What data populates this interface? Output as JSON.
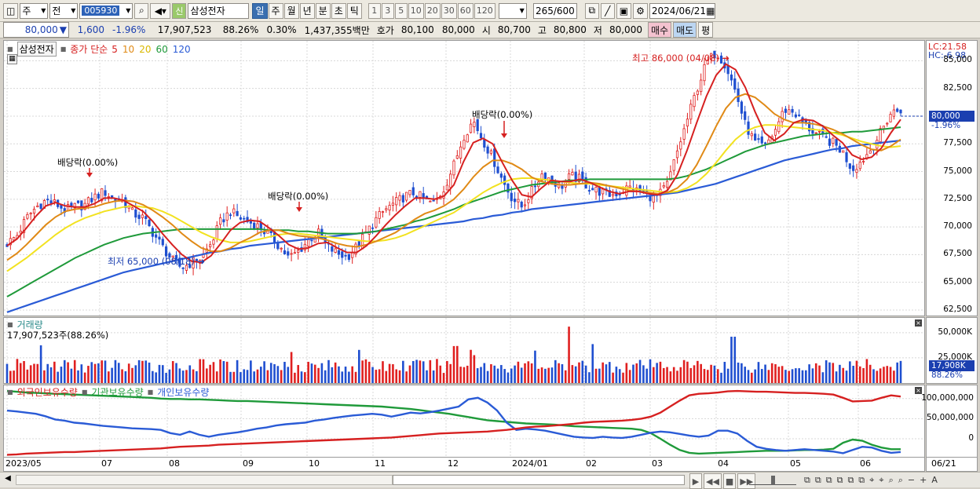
{
  "toolbar": {
    "period": "주",
    "market": "전",
    "code": "005930",
    "new_badge": "신",
    "name": "삼성전자",
    "intervals": [
      "일",
      "주",
      "월",
      "년",
      "분",
      "초",
      "틱"
    ],
    "active_interval": "일",
    "minutes": [
      "1",
      "3",
      "5",
      "10",
      "20",
      "30",
      "60",
      "120"
    ],
    "count": "265",
    "count_total": "/600",
    "date": "2024/06/21"
  },
  "quote": {
    "price": "80,000",
    "arrow": "▼",
    "change": "1,600",
    "change_pct": "-1.96%",
    "volume": "17,907,523",
    "vol_ratio": "88.26%",
    "turnover": "0.30%",
    "amount": "1,437,355백만",
    "hoga_label": "호가",
    "bid": "80,100",
    "ask": "80,000",
    "open_label": "시",
    "open": "80,700",
    "high_label": "고",
    "high": "80,800",
    "low_label": "저",
    "low": "80,000",
    "buy": "매수",
    "sell": "매도",
    "eval": "평"
  },
  "price_panel": {
    "stock_name": "삼성전자",
    "ma_label": "종가 단순",
    "ma_periods": [
      "5",
      "10",
      "20",
      "60",
      "120"
    ],
    "ma_colors": [
      "#d62020",
      "#e08a16",
      "#f2e220",
      "#1f9a3a",
      "#2a5bd6"
    ],
    "lc": "LC:21.58",
    "hc": "HC:-6.98",
    "ticks": [
      "85,000",
      "82,500",
      "80,000",
      "77,500",
      "75,000",
      "72,500",
      "70,000",
      "67,500",
      "65,000",
      "62,500"
    ],
    "current_price": "80,000",
    "current_change": "-1.96%",
    "annotations": {
      "high": "최고 86,000 (04/08)",
      "low": "최저 65,000 (08/18)",
      "div1": "배당락(0.00%)",
      "div2": "배당락(0.00%)",
      "div3": "배당락(0.00%)"
    }
  },
  "volume_panel": {
    "title": "거래량",
    "value": "17,907,523주(88.26%)",
    "ticks": [
      "50,000K",
      "25,000K"
    ],
    "current": "17,908K",
    "current_pct": "88.26%"
  },
  "holding_panel": {
    "series": [
      "외국인보유수량",
      "기관보유수량",
      "개인보유수량"
    ],
    "colors": [
      "#d62020",
      "#1f9a3a",
      "#2a5bd6"
    ],
    "ticks": [
      "100,000,000",
      "50,000,000",
      "0"
    ]
  },
  "x_axis": {
    "labels": [
      "2023/05",
      "07",
      "08",
      "09",
      "10",
      "11",
      "12",
      "2024/01",
      "02",
      "03",
      "04",
      "05",
      "06"
    ],
    "end_label": "06/21"
  },
  "chart_data": {
    "type": "line",
    "price_ylim": [
      62000,
      86800
    ],
    "price_path": [
      68500,
      69200,
      70800,
      71800,
      72400,
      72100,
      71500,
      71800,
      72000,
      72700,
      73200,
      72500,
      72300,
      71200,
      70800,
      69500,
      68200,
      67000,
      66300,
      66800,
      67200,
      68500,
      70500,
      71400,
      70800,
      70400,
      70000,
      69200,
      68300,
      67200,
      67800,
      68800,
      69500,
      68200,
      67600,
      67300,
      68200,
      69500,
      70700,
      71600,
      72200,
      72800,
      73100,
      72400,
      72100,
      73500,
      75600,
      78200,
      79600,
      77800,
      76200,
      74200,
      72600,
      71800,
      73200,
      74800,
      74300,
      73600,
      74600,
      74300,
      73500,
      73200,
      72900,
      73100,
      73600,
      73200,
      72800,
      72700,
      73900,
      76800,
      79600,
      82400,
      84800,
      85800,
      84600,
      82200,
      79200,
      77600,
      77200,
      78600,
      80600,
      80400,
      79300,
      78600,
      78000,
      77600,
      76800,
      75200,
      76000,
      77100,
      78600,
      80300,
      80600
    ],
    "ma_daily": [
      {
        "period": "5",
        "values": [
          68300,
          68900,
          69900,
          71000,
          71900,
          72200,
          71900,
          71800,
          71800,
          72100,
          72600,
          72600,
          72400,
          71900,
          71400,
          70500,
          69400,
          68400,
          67500,
          66900,
          66800,
          67400,
          68500,
          69700,
          70400,
          70600,
          70500,
          69900,
          69200,
          68400,
          68000,
          68100,
          68500,
          68600,
          68100,
          67700,
          67700,
          68300,
          69200,
          70200,
          71100,
          71900,
          72600,
          72600,
          72500,
          72800,
          73800,
          75900,
          77600,
          78000,
          77500,
          75800,
          74200,
          72900,
          72700,
          73500,
          74200,
          74100,
          74100,
          74300,
          74000,
          73600,
          73200,
          73000,
          73200,
          73200,
          73000,
          72900,
          73300,
          74700,
          76900,
          79400,
          81800,
          83700,
          84700,
          84200,
          82600,
          80400,
          78500,
          77800,
          78400,
          79400,
          79700,
          79600,
          79100,
          78300,
          77600,
          76500,
          76100,
          76300,
          77100,
          78500,
          79700
        ]
      },
      {
        "period": "10",
        "values": [
          67000,
          67600,
          68400,
          69300,
          70200,
          70900,
          71400,
          71600,
          71700,
          71800,
          72100,
          72300,
          72400,
          72300,
          72000,
          71500,
          70900,
          70200,
          69400,
          68700,
          68100,
          67800,
          67800,
          68100,
          68600,
          69000,
          69500,
          69700,
          69700,
          69400,
          69200,
          69100,
          69000,
          68800,
          68500,
          68300,
          68200,
          68400,
          68700,
          69100,
          69500,
          70100,
          70700,
          71200,
          71500,
          71900,
          72500,
          73400,
          74500,
          75400,
          76000,
          76000,
          75700,
          75200,
          74500,
          74100,
          73900,
          73800,
          73800,
          73900,
          74000,
          73900,
          73700,
          73500,
          73300,
          73200,
          73100,
          73000,
          73100,
          73500,
          74300,
          75600,
          77300,
          79100,
          80700,
          81700,
          82000,
          81700,
          81000,
          80200,
          79700,
          79400,
          79400,
          79300,
          79100,
          78800,
          78400,
          77900,
          77400,
          77000,
          76900,
          77300,
          77900
        ]
      },
      {
        "period": "20",
        "values": [
          66000,
          66600,
          67200,
          67900,
          68600,
          69300,
          69900,
          70400,
          70800,
          71100,
          71400,
          71600,
          71800,
          71900,
          71800,
          71700,
          71400,
          71000,
          70500,
          70000,
          69500,
          69100,
          68800,
          68600,
          68600,
          68700,
          68900,
          69100,
          69300,
          69400,
          69400,
          69300,
          69200,
          69100,
          69000,
          68900,
          68800,
          68700,
          68700,
          68800,
          69000,
          69300,
          69700,
          70100,
          70500,
          70900,
          71300,
          71900,
          72500,
          73100,
          73600,
          74000,
          74300,
          74400,
          74400,
          74300,
          74200,
          74100,
          74000,
          73900,
          73900,
          73800,
          73700,
          73600,
          73500,
          73400,
          73300,
          73200,
          73100,
          73200,
          73500,
          74000,
          74800,
          75800,
          76900,
          77900,
          78600,
          79000,
          79200,
          79200,
          79100,
          79000,
          78900,
          78800,
          78700,
          78500,
          78300,
          78000,
          77700,
          77500,
          77300,
          77200,
          77300
        ]
      },
      {
        "period": "60",
        "values": [
          63700,
          64200,
          64700,
          65200,
          65700,
          66200,
          66700,
          67200,
          67600,
          68000,
          68400,
          68700,
          69000,
          69200,
          69400,
          69500,
          69600,
          69700,
          69800,
          69800,
          69800,
          69800,
          69800,
          69800,
          69800,
          69800,
          69800,
          69700,
          69700,
          69700,
          69600,
          69600,
          69500,
          69400,
          69400,
          69400,
          69400,
          69500,
          69600,
          69800,
          70000,
          70200,
          70500,
          70700,
          71000,
          71300,
          71600,
          72000,
          72300,
          72600,
          72900,
          73200,
          73400,
          73600,
          73800,
          73900,
          74000,
          74100,
          74200,
          74200,
          74300,
          74300,
          74300,
          74300,
          74300,
          74300,
          74300,
          74300,
          74300,
          74400,
          74600,
          74900,
          75200,
          75600,
          76000,
          76400,
          76800,
          77100,
          77400,
          77600,
          77800,
          78000,
          78200,
          78300,
          78400,
          78500,
          78500,
          78600,
          78600,
          78700,
          78800,
          78900,
          79000
        ]
      },
      {
        "period": "120",
        "values": [
          62300,
          62600,
          62900,
          63200,
          63500,
          63800,
          64100,
          64400,
          64700,
          65000,
          65300,
          65600,
          65900,
          66100,
          66300,
          66500,
          66700,
          66900,
          67100,
          67300,
          67500,
          67700,
          67800,
          68000,
          68100,
          68300,
          68400,
          68500,
          68600,
          68700,
          68800,
          68900,
          69000,
          69100,
          69200,
          69300,
          69400,
          69500,
          69600,
          69700,
          69800,
          69900,
          70000,
          70100,
          70200,
          70300,
          70400,
          70500,
          70700,
          70800,
          71000,
          71100,
          71300,
          71400,
          71600,
          71700,
          71800,
          71900,
          72000,
          72100,
          72200,
          72300,
          72400,
          72500,
          72600,
          72700,
          72800,
          72900,
          73000,
          73100,
          73300,
          73500,
          73700,
          73900,
          74200,
          74500,
          74800,
          75100,
          75400,
          75700,
          76000,
          76200,
          76400,
          76600,
          76800,
          77000,
          77100,
          77300,
          77400,
          77500,
          77600,
          77700,
          77800
        ]
      }
    ],
    "volume_ylim": [
      0,
      60000
    ],
    "holding_ylim": [
      -45000000,
      125000000
    ],
    "foreign_path": [
      -40000000,
      -39000000,
      -37000000,
      -36000000,
      -35000000,
      -34000000,
      -33000000,
      -33000000,
      -32000000,
      -31000000,
      -30000000,
      -29000000,
      -28000000,
      -27000000,
      -26000000,
      -25000000,
      -24000000,
      -22000000,
      -20000000,
      -19000000,
      -18000000,
      -17000000,
      -15000000,
      -14000000,
      -13000000,
      -12000000,
      -11000000,
      -10000000,
      -9000000,
      -8000000,
      -7000000,
      -6000000,
      -5000000,
      -4000000,
      -3000000,
      -2000000,
      -1000000,
      0,
      1000000,
      2000000,
      3000000,
      5000000,
      7000000,
      9000000,
      11000000,
      13000000,
      14000000,
      15000000,
      16000000,
      17000000,
      18000000,
      20000000,
      22000000,
      25000000,
      28000000,
      30000000,
      31000000,
      33000000,
      35000000,
      37000000,
      40000000,
      42000000,
      43000000,
      44000000,
      45000000,
      47000000,
      50000000,
      55000000,
      65000000,
      80000000,
      95000000,
      108000000,
      112000000,
      113000000,
      115000000,
      118000000,
      119000000,
      118000000,
      117000000,
      117000000,
      116000000,
      115000000,
      114000000,
      114000000,
      113000000,
      112000000,
      110000000,
      102000000,
      93000000,
      94000000,
      95000000,
      102000000,
      108000000,
      105000000
    ],
    "inst_path": [
      119000000,
      117000000,
      115000000,
      114000000,
      113000000,
      112000000,
      111000000,
      110000000,
      109000000,
      108000000,
      107000000,
      106000000,
      105000000,
      104000000,
      103000000,
      102000000,
      100000000,
      99000000,
      99000000,
      98000000,
      98000000,
      97000000,
      96000000,
      95000000,
      94000000,
      94000000,
      93000000,
      92000000,
      91000000,
      90000000,
      89000000,
      88000000,
      87000000,
      86000000,
      85000000,
      84000000,
      83000000,
      82000000,
      81000000,
      80000000,
      78000000,
      76000000,
      74000000,
      71000000,
      68000000,
      65000000,
      62000000,
      58000000,
      54000000,
      50000000,
      46000000,
      44000000,
      42000000,
      40000000,
      38000000,
      37000000,
      36000000,
      35000000,
      33000000,
      31000000,
      30000000,
      29000000,
      28000000,
      27000000,
      26000000,
      25000000,
      22000000,
      14000000,
      0,
      -15000000,
      -28000000,
      -35000000,
      -37000000,
      -36000000,
      -35000000,
      -34000000,
      -33000000,
      -32000000,
      -31000000,
      -30000000,
      -30000000,
      -30000000,
      -29000000,
      -28000000,
      -28000000,
      -27000000,
      -25000000,
      -10000000,
      -2000000,
      -5000000,
      -15000000,
      -22000000,
      -26000000,
      -26000000
    ],
    "indiv_path": [
      70000000,
      68000000,
      65000000,
      62000000,
      56000000,
      48000000,
      45000000,
      40000000,
      38000000,
      35000000,
      32000000,
      30000000,
      28000000,
      26000000,
      25000000,
      24000000,
      22000000,
      14000000,
      10000000,
      18000000,
      10000000,
      5000000,
      10000000,
      13000000,
      16000000,
      20000000,
      25000000,
      28000000,
      33000000,
      36000000,
      38000000,
      40000000,
      45000000,
      48000000,
      52000000,
      55000000,
      58000000,
      60000000,
      62000000,
      60000000,
      55000000,
      60000000,
      65000000,
      63000000,
      66000000,
      70000000,
      75000000,
      80000000,
      98000000,
      102000000,
      90000000,
      70000000,
      40000000,
      22000000,
      25000000,
      23000000,
      20000000,
      15000000,
      10000000,
      5000000,
      3000000,
      2000000,
      5000000,
      3000000,
      2000000,
      5000000,
      10000000,
      15000000,
      18000000,
      16000000,
      12000000,
      8000000,
      5000000,
      8000000,
      20000000,
      20000000,
      13000000,
      -5000000,
      -20000000,
      -25000000,
      -28000000,
      -30000000,
      -28000000,
      -26000000,
      -28000000,
      -30000000,
      -32000000,
      -36000000,
      -28000000,
      -20000000,
      -22000000,
      -30000000,
      -35000000,
      -33000000
    ]
  }
}
